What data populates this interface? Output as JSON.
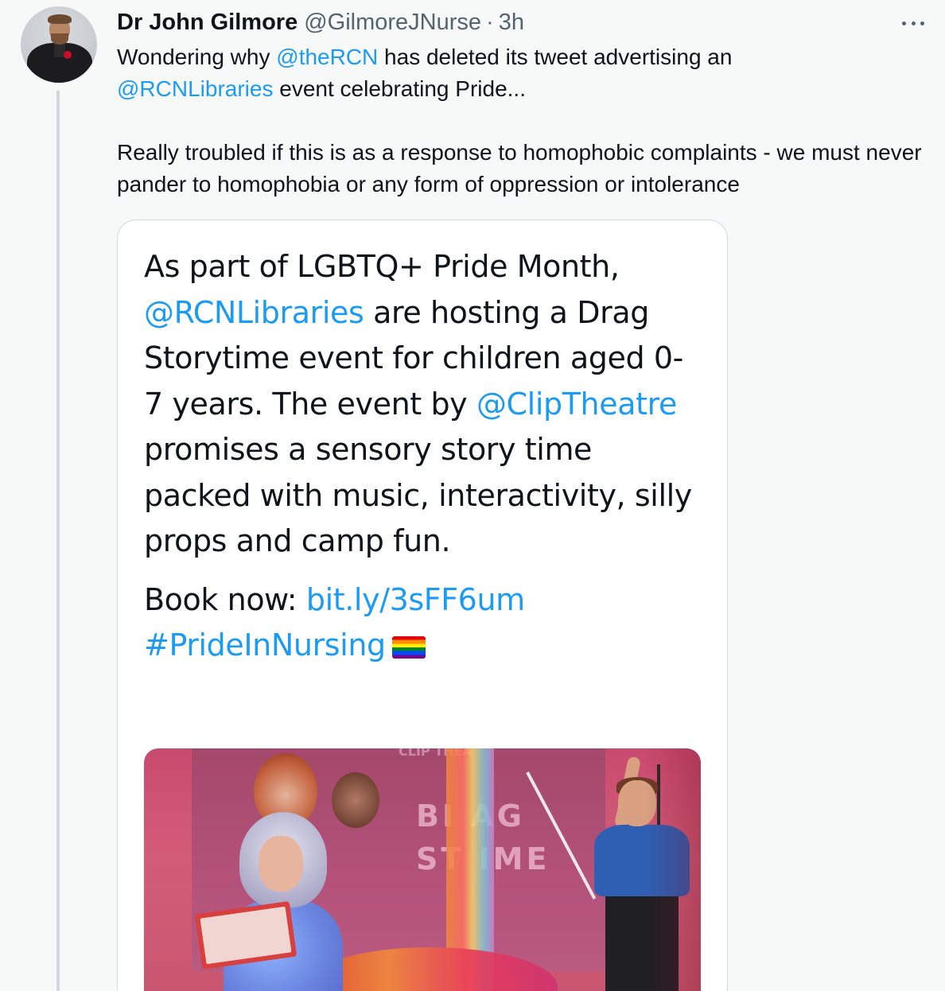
{
  "author": {
    "name": "Dr John Gilmore",
    "handle": "@GilmoreJNurse",
    "separator": "·",
    "time": "3h"
  },
  "tweet": {
    "line1_a": "Wondering why ",
    "mention_rcn": "@theRCN",
    "line1_b": " has deleted its tweet advertising an",
    "mention_libraries": "@RCNLibraries",
    "line2_b": " event celebrating Pride...",
    "paragraph2": "Really troubled if this is as a response to homophobic complaints - we must never pander to homophobia or any form of oppression or intolerance"
  },
  "quoted": {
    "text_a": "As part of LGBTQ+ Pride Month, ",
    "mention_libraries": "@RCNLibraries",
    "text_b": " are hosting a Drag Storytime event for children aged 0-7 years. The event by ",
    "mention_clip": "@ClipTheatre",
    "text_c": " promises a sensory story time packed with music, interactivity, silly props and camp fun.",
    "book_label": "Book now: ",
    "link": "bit.ly/3sFF6um",
    "hashtag": "#PrideInNursing",
    "flag_emoji": "rainbow-flag-icon"
  },
  "photo": {
    "screen_top_text": "CLIP THEA",
    "screen_line1": "BI   AG",
    "screen_line2": "ST    IME"
  },
  "colors": {
    "link": "#1d9bf0",
    "text": "#0f1419",
    "secondary": "#536471",
    "border": "#cfd9de",
    "background": "#f7f8f8"
  }
}
